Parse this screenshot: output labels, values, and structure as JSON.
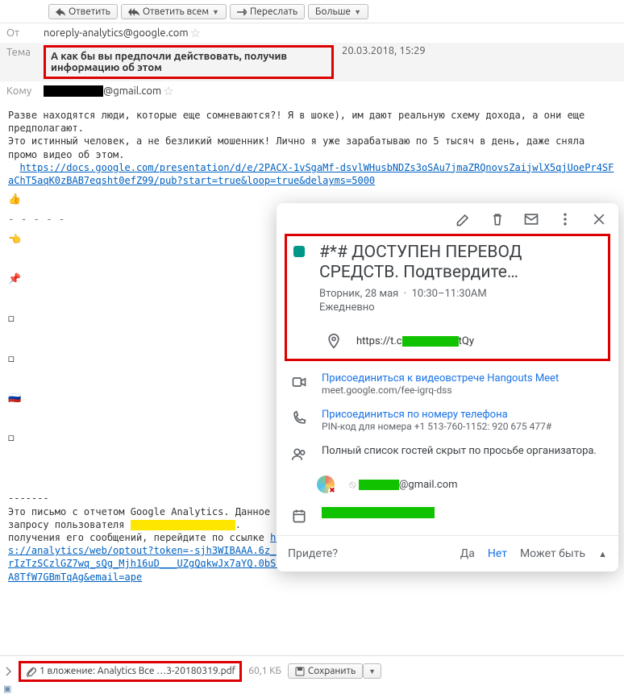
{
  "toolbar": {
    "reply": "Ответить",
    "reply_all": "Ответить всем",
    "forward": "Переслать",
    "more": "Больше"
  },
  "header": {
    "from_label": "От",
    "from_value": "noreply-analytics@google.com",
    "subject_label": "Тема",
    "subject_value": "А как бы вы предпочли действовать, получив информацию об этом",
    "date": "20.03.2018, 15:29",
    "to_label": "Кому",
    "to_suffix": "@gmail.com"
  },
  "body": {
    "p1": "Разве находятся люди, которые еще сомневаются?! Я в шоке), им дают реальную схему дохода, а они еще предполагают.",
    "p2": "Это истинный человек, а не безликий мошенник! Лично я уже зарабатываю по 5 тысяч в день, даже сняла промо видео об этом.",
    "link1": "https://docs.google.com/presentation/d/e/2PACX-1vSgaMf-dsvlWHusbNDZs3oSAu7jmaZRQnovsZaijwlX5qjUoePr4SFaChT5aqK0zBAB7eqsht0efZ99/pub?start=true&loop=true&delayms=5000"
  },
  "bullets": [
    "👍",
    "👈",
    "📌",
    "◻",
    "◻",
    "🇷🇺",
    "◻"
  ],
  "footer_text": {
    "sep": "-------",
    "l1": "Это письмо с отчетом Google Analytics. Данное",
    "l2a": "запросу пользователя ",
    "l2b": ".",
    "l3a": "получения его сообщений, перейдите по ссылке ",
    "link2": "https://analytics/web/optout?token=-sjh3WIBAAA.6z_mFMa3BrIzTzSCzlGZ7wq_sQg_Mjh16uD___UZgQqkwJx7aYQ.0bSCHvTaJA8TfW7GBmTqAg&email=ape"
  },
  "attach": {
    "label": "1 вложение: Analytics Все …3-20180319.pdf",
    "size": "60,1 КБ",
    "save": "Сохранить"
  },
  "gcal": {
    "title": "#*# ДОСТУПЕН ПЕРЕВОД СРЕДСТВ. Подтвердите…",
    "date": "Вторник, 28 мая",
    "time": "10:30–11:30AM",
    "recur": "Ежедневно",
    "loc_prefix": "https://t.c",
    "loc_suffix": "tQy",
    "meet_label": "Присоединиться к видеовстрече Hangouts Meet",
    "meet_url": "meet.google.com/fee-igrq-dss",
    "phone_label": "Присоединиться по номеру телефона",
    "phone_sub": "PIN-код для номера +1 513-760-1152: 920 675 477#",
    "guests": "Полный список гостей скрыт по просьбе организатора.",
    "org_suffix": "@gmail.com",
    "rsvp_q": "Придете?",
    "yes": "Да",
    "no": "Нет",
    "maybe": "Может быть"
  }
}
